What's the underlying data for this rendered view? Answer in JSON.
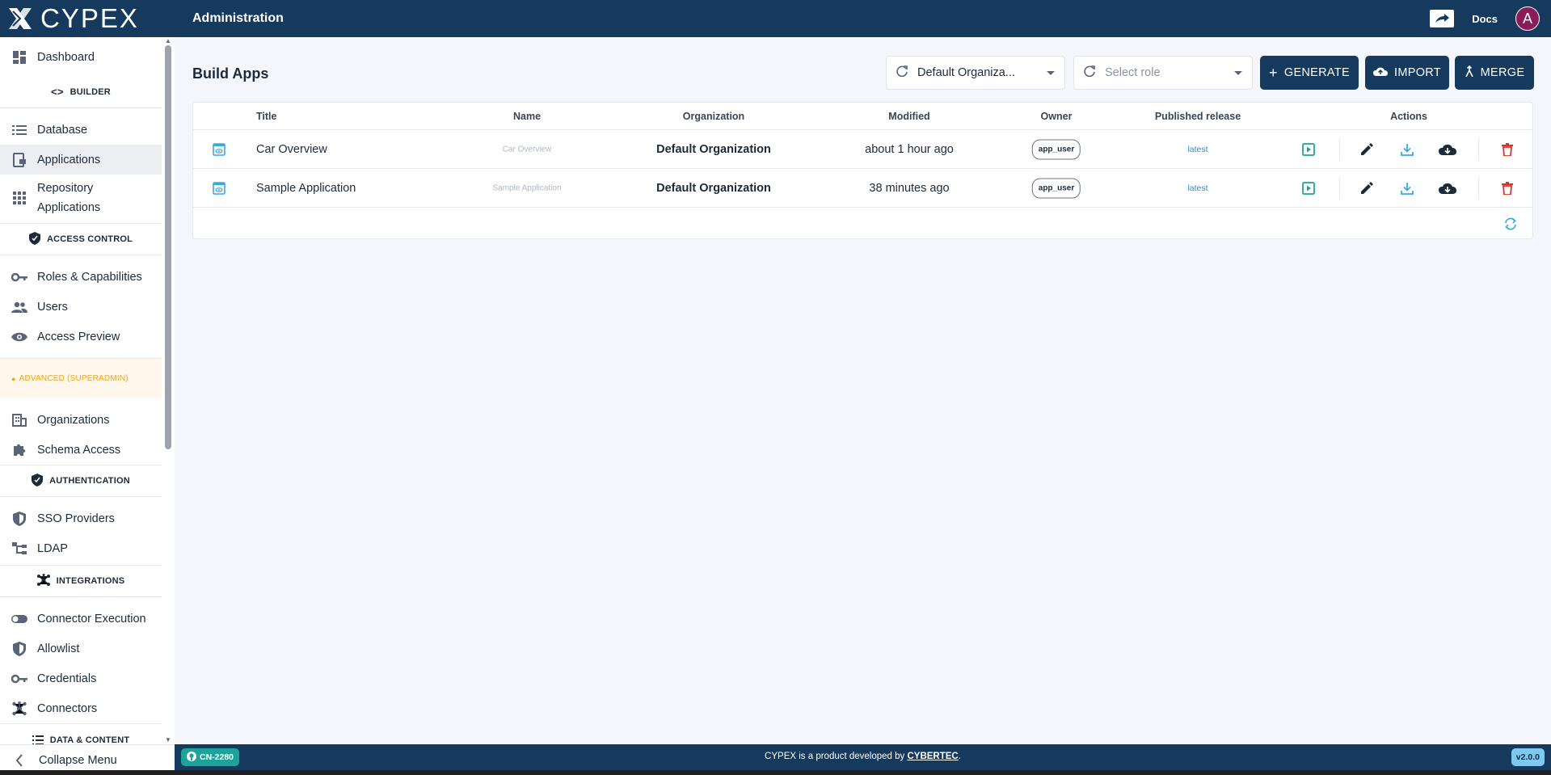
{
  "app": {
    "brand": "CYPEX",
    "header_title": "Administration",
    "docs_label": "Docs",
    "avatar_letter": "A"
  },
  "sidebar": {
    "items": [
      {
        "label": "Dashboard",
        "icon": "dashboard-icon"
      },
      {
        "label": "Database",
        "icon": "list-icon"
      },
      {
        "label": "Applications",
        "icon": "application-icon"
      },
      {
        "label": "Repository Applications",
        "icon": "apps-grid-icon"
      },
      {
        "label": "Roles & Capabilities",
        "icon": "key-icon"
      },
      {
        "label": "Users",
        "icon": "people-icon"
      },
      {
        "label": "Access Preview",
        "icon": "eye-icon"
      },
      {
        "label": "Organizations",
        "icon": "building-icon"
      },
      {
        "label": "Schema Access",
        "icon": "puzzle-icon"
      },
      {
        "label": "SSO Providers",
        "icon": "shield-icon"
      },
      {
        "label": "LDAP",
        "icon": "tree-icon"
      },
      {
        "label": "Connector Execution",
        "icon": "toggle-icon"
      },
      {
        "label": "Allowlist",
        "icon": "shield-icon"
      },
      {
        "label": "Credentials",
        "icon": "key-icon"
      },
      {
        "label": "Connectors",
        "icon": "hub-icon"
      }
    ],
    "sections": {
      "builder": "BUILDER",
      "access_control": "ACCESS CONTROL",
      "advanced": "ADVANCED (SUPERADMIN)",
      "authentication": "AUTHENTICATION",
      "integrations": "INTEGRATIONS",
      "data_content": "DATA & CONTENT"
    },
    "collapse_label": "Collapse Menu"
  },
  "main": {
    "page_title": "Build Apps",
    "org_select_value": "Default Organiza...",
    "role_select_placeholder": "Select role",
    "buttons": {
      "generate": "GENERATE",
      "import": "IMPORT",
      "merge": "MERGE"
    },
    "table": {
      "headers": {
        "title": "Title",
        "name": "Name",
        "organization": "Organization",
        "modified": "Modified",
        "owner": "Owner",
        "published": "Published release",
        "actions": "Actions"
      },
      "rows": [
        {
          "title": "Car Overview",
          "name": "Car Overview",
          "organization": "Default Organization",
          "modified": "about 1 hour ago",
          "owner": "app_user",
          "release": "latest"
        },
        {
          "title": "Sample Application",
          "name": "Sample Application",
          "organization": "Default Organization",
          "modified": "38 minutes ago",
          "owner": "app_user",
          "release": "latest"
        }
      ]
    }
  },
  "footer": {
    "branch_badge": "CN-2280",
    "text_prefix": "CYPEX is a product developed by ",
    "link": "CYBERTEC",
    "text_suffix": ".",
    "version": "v2.0.0"
  },
  "colors": {
    "primary": "#163a5e",
    "accent_blue": "#3a86c8",
    "teal": "#1ea39a",
    "danger": "#d9342b",
    "warning": "#f0a412"
  }
}
